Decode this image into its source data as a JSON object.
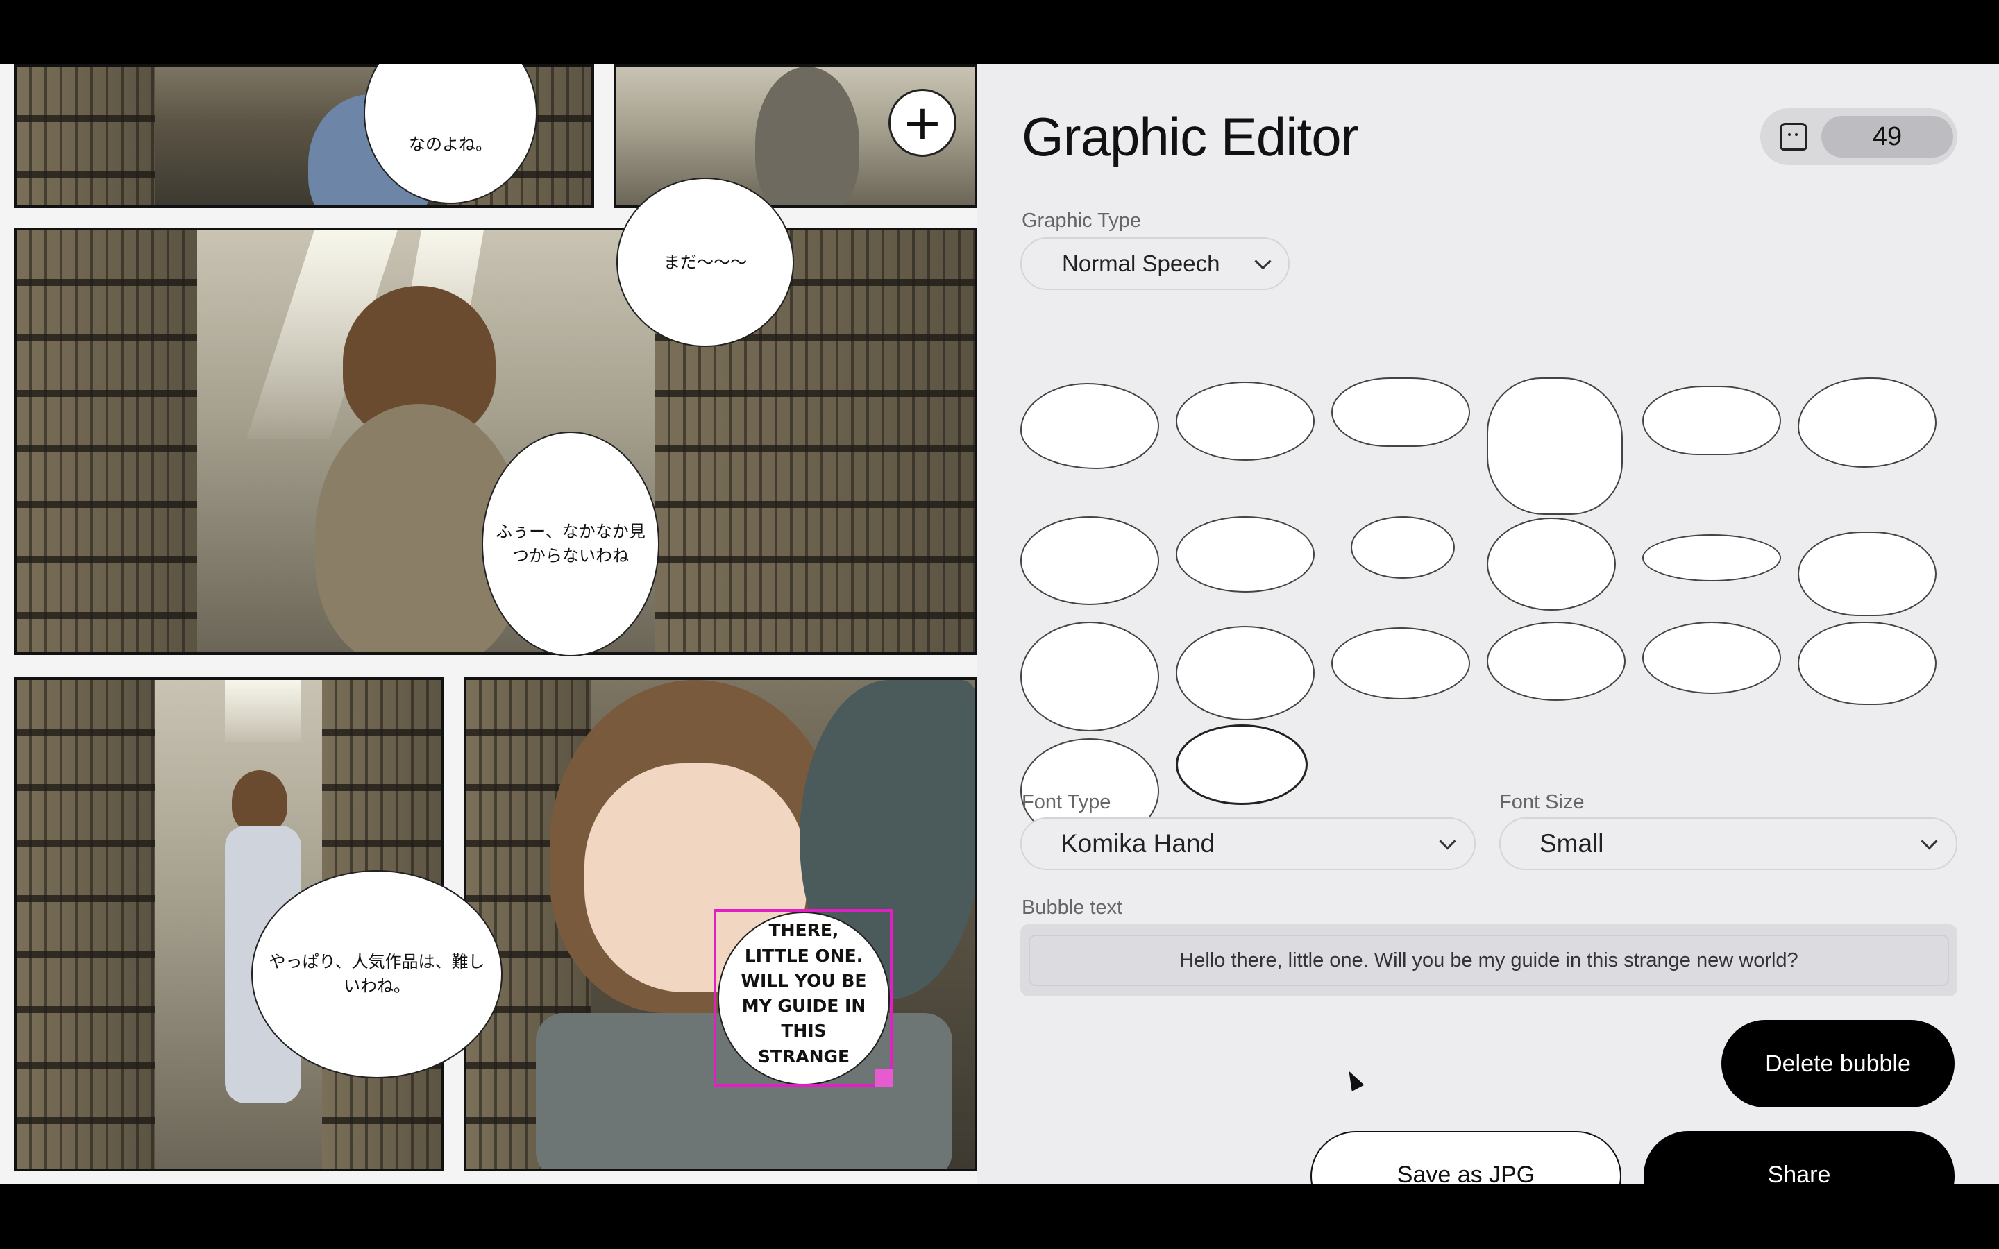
{
  "editor": {
    "title": "Graphic Editor",
    "credits": "49",
    "graphic_type_label": "Graphic Type",
    "graphic_type_value": "Normal Speech",
    "font_type_label": "Font Type",
    "font_type_value": "Komika Hand",
    "font_size_label": "Font Size",
    "font_size_value": "Small",
    "bubble_text_label": "Bubble text",
    "bubble_text_value": "Hello there, little one. Will you be my guide in this strange new world?",
    "delete_label": "Delete bubble",
    "save_label": "Save as JPG",
    "share_label": "Share"
  },
  "comic": {
    "bubble_top_left": "なのよね。",
    "bubble_top_right": "まだ〜〜〜",
    "bubble_middle": "ふぅー、なかなか見つからないわね",
    "bubble_bottom_left": "やっぱり、人気作品は、難しいわね。",
    "bubble_selected_lines": [
      "THERE,",
      "LITTLE ONE.",
      "WILL YOU BE",
      "MY GUIDE IN",
      "THIS",
      "STRANGE"
    ]
  },
  "icons": {
    "add": "plus-icon",
    "credits": "bread-icon",
    "dropdown": "chevron-down-icon"
  },
  "colors": {
    "selection": "#e11fc4",
    "button_dark": "#000000"
  }
}
